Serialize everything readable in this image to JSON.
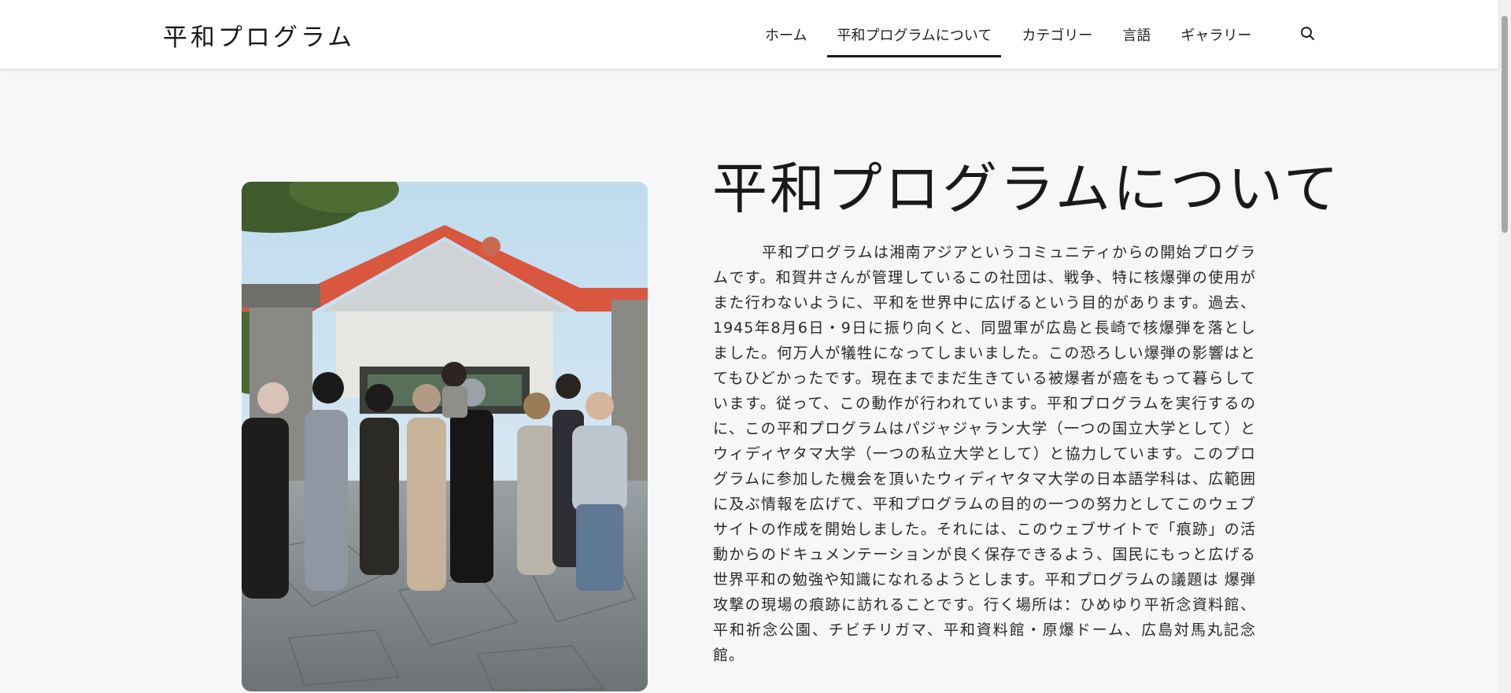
{
  "header": {
    "site_title": "平和プログラム",
    "nav": [
      {
        "label": "ホーム",
        "active": false
      },
      {
        "label": "平和プログラムについて",
        "active": true
      },
      {
        "label": "カテゴリー",
        "active": false
      },
      {
        "label": "言語",
        "active": false
      },
      {
        "label": "ギャラリー",
        "active": false
      }
    ],
    "search_icon": "search-icon"
  },
  "main": {
    "heading": "平和プログラムについて",
    "paragraph": "平和プログラムは湘南アジアというコミュニティからの開始プログラムです。和賀井さんが管理しているこの社団は、戦争、特に核爆弾の使用がまた行わないように、平和を世界中に広げるという目的があります。過去、1945年8月6日・9日に振り向くと、同盟軍が広島と長崎で核爆弾を落としました。何万人が犠牲になってしまいました。この恐ろしい爆弾の影響はとてもひどかったです。現在までまだ生きている被爆者が癌をもって暮らしています。従って、この動作が行われています。平和プログラムを実行するのに、この平和プログラムはパジャジャラン大学（一つの国立大学として）とウィディヤタマ大学（一つの私立大学として）と協力しています。このプログラムに参加した機会を頂いたウィディヤタマ大学の日本語学科は、広範囲に及ぶ情報を広げて、平和プログラムの目的の一つの努力としてこのウェブサイトの作成を開始しました。それには、このウェブサイトで「痕跡」の活動からのドキュメンテーションが良く保存できるよう、国民にもっと広げる世界平和の勉強や知識になれるようとします。平和プログラムの議題は 爆弾攻撃の現場の痕跡に訪れることです。行く場所は：ひめゆり平祈念資料館、平和祈念公園、チビチリガマ、平和資料館・原爆ドーム、広島対馬丸記念館。",
    "photo_icon": "group-photo"
  },
  "colors": {
    "header_bg": "#ffffff",
    "page_bg": "#f7f7f7",
    "text": "#222222",
    "roof": "#d9573f"
  }
}
